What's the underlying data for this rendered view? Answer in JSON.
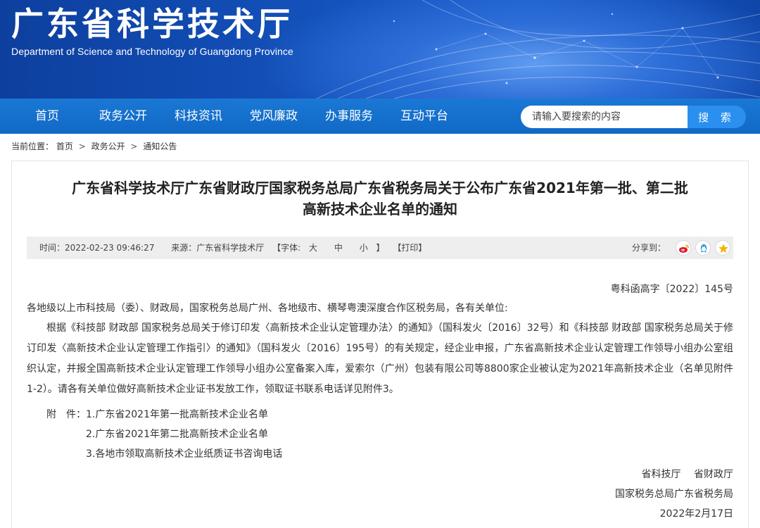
{
  "header": {
    "title": "广东省科学技术厅",
    "subtitle": "Department of Science and Technology of Guangdong Province"
  },
  "nav": {
    "items": [
      {
        "label": "首页"
      },
      {
        "label": "政务公开"
      },
      {
        "label": "科技资讯"
      },
      {
        "label": "党风廉政"
      },
      {
        "label": "办事服务"
      },
      {
        "label": "互动平台"
      }
    ]
  },
  "search": {
    "placeholder": "请输入要搜索的内容",
    "button_label": "搜 索"
  },
  "breadcrumb": {
    "prefix": "当前位置：",
    "items": [
      "首页",
      "政务公开",
      "通知公告"
    ],
    "separator": ">"
  },
  "article": {
    "title_line1": "广东省科学技术厅广东省财政厅国家税务总局广东省税务局关于公布广东省2021年第一批、第二批",
    "title_line2": "高新技术企业名单的通知",
    "meta": {
      "time": "时间：2022-02-23 09:46:27",
      "source": "来源：广东省科学技术厅",
      "font_open": "【字体:",
      "font_large": "大",
      "font_medium": "中",
      "font_small": "小",
      "font_close": "】",
      "print": "【打印】",
      "share_label": "分享到："
    },
    "doc_number": "粤科函高字〔2022〕145号",
    "addressee": "各地级以上市科技局（委）、财政局，国家税务总局广州、各地级市、横琴粤澳深度合作区税务局，各有关单位:",
    "body": "根据《科技部 财政部 国家税务总局关于修订印发〈高新技术企业认定管理办法〉的通知》（国科发火〔2016〕32号）和《科技部 财政部 国家税务总局关于修订印发〈高新技术企业认定管理工作指引〉的通知》（国科发火〔2016〕195号）的有关规定，经企业申报，广东省高新技术企业认定管理工作领导小组办公室组织认定，并报全国高新技术企业认定管理工作领导小组办公室备案入库，爱索尔（广州）包装有限公司等8800家企业被认定为2021年高新技术企业（名单见附件1-2）。请各有关单位做好高新技术企业证书发放工作，领取证书联系电话详见附件3。",
    "attachments_label": "附　件：",
    "attachments": [
      "1.广东省2021年第一批高新技术企业名单",
      "2.广东省2021年第二批高新技术企业名单",
      "3.各地市领取高新技术企业纸质证书咨询电话"
    ],
    "signature": {
      "line1": "省科技厅　 省财政厅",
      "line2": "国家税务总局广东省税务局",
      "date": "2022年2月17日"
    }
  },
  "colors": {
    "banner": "#1453bd",
    "nav": "#1169c6",
    "search_button": "#2b8ff0",
    "weibo": "#e6162d",
    "qq": "#1e9bd7",
    "qzone": "#f5b400"
  },
  "share_icons": [
    "weibo-icon",
    "qq-icon",
    "qzone-icon"
  ]
}
